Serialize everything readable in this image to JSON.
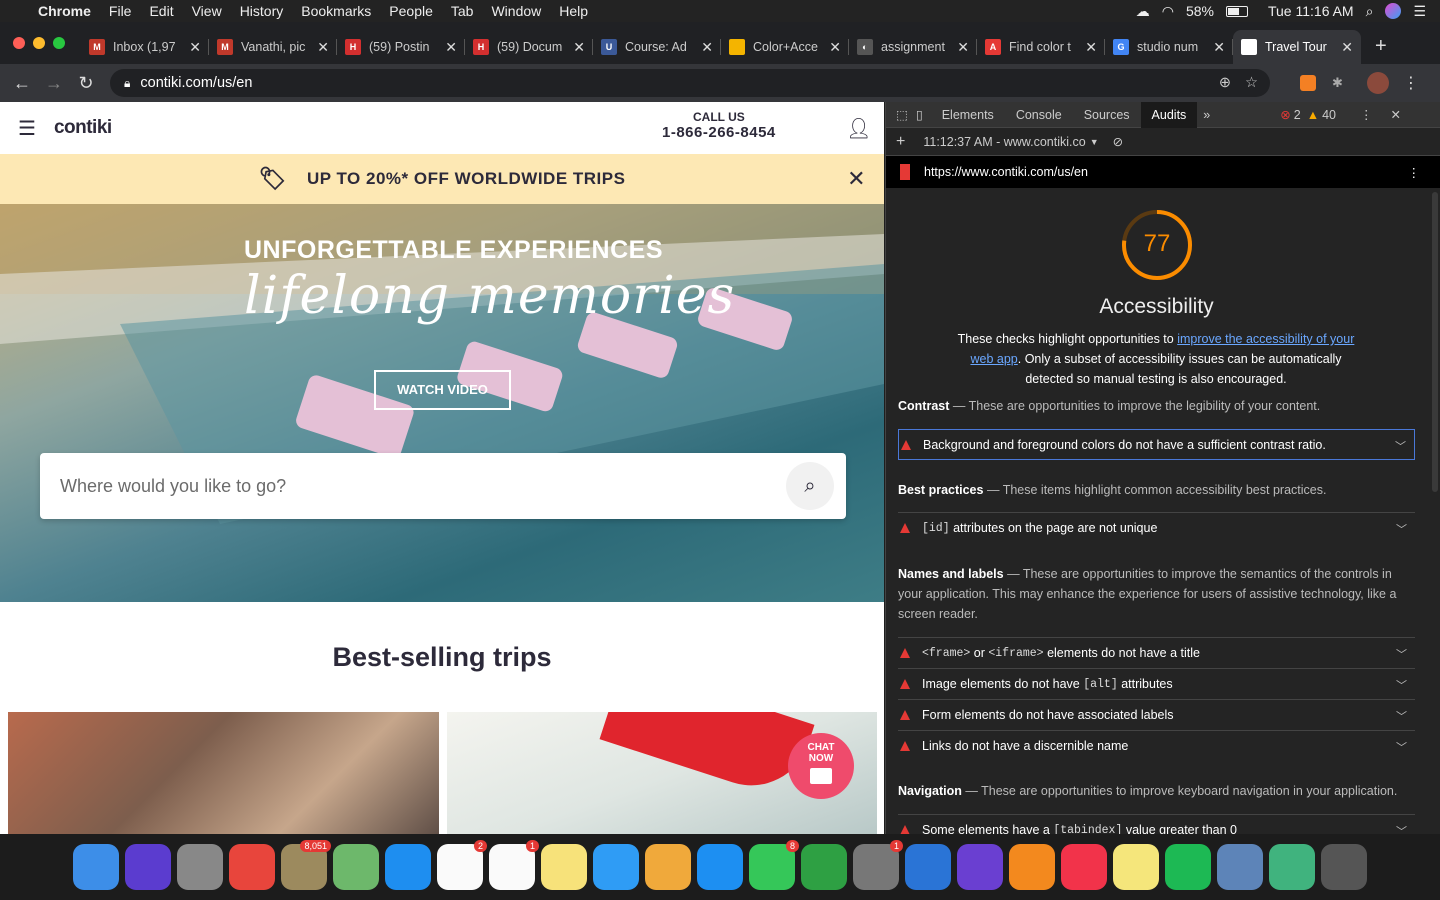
{
  "menubar": {
    "app": "Chrome",
    "items": [
      "File",
      "Edit",
      "View",
      "History",
      "Bookmarks",
      "People",
      "Tab",
      "Window",
      "Help"
    ],
    "battery": "58%",
    "clock": "Tue 11:16 AM"
  },
  "tabs": [
    {
      "title": "Inbox (1,97",
      "fav": "#c0392b",
      "favtext": "M"
    },
    {
      "title": "Vanathi, pic",
      "fav": "#c0392b",
      "favtext": "M"
    },
    {
      "title": "(59) Postin",
      "fav": "#d32f2f",
      "favtext": "H"
    },
    {
      "title": "(59) Docum",
      "fav": "#d32f2f",
      "favtext": "H"
    },
    {
      "title": "Course: Ad",
      "fav": "#3b5998",
      "favtext": "U"
    },
    {
      "title": "Color+Acce",
      "fav": "#f4b400",
      "favtext": ""
    },
    {
      "title": "assignment",
      "fav": "#555",
      "favtext": "◐"
    },
    {
      "title": "Find color t",
      "fav": "#e53935",
      "favtext": "A"
    },
    {
      "title": "studio num",
      "fav": "#4285f4",
      "favtext": "G"
    },
    {
      "title": "Travel Tour",
      "fav": "#fff",
      "favtext": "",
      "active": true
    }
  ],
  "address": {
    "url": "contiki.com/us/en"
  },
  "site": {
    "logo": "contiki",
    "call_label": "CALL US",
    "phone": "1-866-266-8454",
    "promo": "UP TO 20%* OFF WORLDWIDE TRIPS",
    "hero_title": "UNFORGETTABLE EXPERIENCES",
    "hero_script": "lifelong memories",
    "watch_video": "WATCH VIDEO",
    "search_placeholder": "Where would you like to go?",
    "best_selling": "Best-selling trips",
    "chat_line1": "CHAT",
    "chat_line2": "NOW"
  },
  "devtools": {
    "tabs": [
      "Elements",
      "Console",
      "Sources",
      "Audits"
    ],
    "errors": "2",
    "warnings": "40",
    "session": "11:12:37 AM - www.contiki.co",
    "audit_url": "https://www.contiki.com/us/en",
    "score": "77",
    "score_color": "#fb8c00",
    "category": "Accessibility",
    "intro_pre": "These checks highlight opportunities to ",
    "intro_link": "improve the accessibility of your web app",
    "intro_post": ". Only a subset of accessibility issues can be automatically detected so manual testing is also encouraged.",
    "contrast_title": "Contrast",
    "contrast_desc": "These are opportunities to improve the legibility of your content.",
    "contrast_item": "Background and foreground colors do not have a sufficient contrast ratio.",
    "bp_title": "Best practices",
    "bp_desc": "These items highlight common accessibility best practices.",
    "bp_item_code": "[id]",
    "bp_item_text": " attributes on the page are not unique",
    "names_title": "Names and labels",
    "names_desc": "These are opportunities to improve the semantics of the controls in your application. This may enhance the experience for users of assistive technology, like a screen reader.",
    "names_item1_code1": "<frame>",
    "names_item1_mid": " or ",
    "names_item1_code2": "<iframe>",
    "names_item1_text": " elements do not have a title",
    "names_item2_pre": "Image elements do not have ",
    "names_item2_code": "[alt]",
    "names_item2_post": " attributes",
    "names_item3": "Form elements do not have associated labels",
    "names_item4": "Links do not have a discernible name",
    "nav_title": "Navigation",
    "nav_desc": "These are opportunities to improve keyboard navigation in your application.",
    "nav_item_pre": "Some elements have a ",
    "nav_item_code": "[tabindex]",
    "nav_item_post": " value greater than 0"
  },
  "dock": [
    {
      "name": "finder-icon",
      "color": "#3d8ee8"
    },
    {
      "name": "siri-icon",
      "color": "#5b3ccf"
    },
    {
      "name": "launchpad-icon",
      "color": "#888"
    },
    {
      "name": "chrome-icon",
      "color": "#e8453c"
    },
    {
      "name": "mail-icon",
      "color": "#9c8a5e",
      "badge": "8,051"
    },
    {
      "name": "maps-icon",
      "color": "#6db86b"
    },
    {
      "name": "safari-icon",
      "color": "#1e8ef0"
    },
    {
      "name": "calendar-icon",
      "color": "#fafafa",
      "badge": "2"
    },
    {
      "name": "reminders-icon",
      "color": "#fafafa",
      "badge": "1"
    },
    {
      "name": "notes-icon",
      "color": "#f7e27a"
    },
    {
      "name": "messages-icon",
      "color": "#2f9cf5"
    },
    {
      "name": "photos-icon",
      "color": "#f0a93b"
    },
    {
      "name": "appstore-icon",
      "color": "#1d8ff2"
    },
    {
      "name": "facetime-icon",
      "color": "#35c759",
      "badge": "8"
    },
    {
      "name": "numbers-icon",
      "color": "#2ea043"
    },
    {
      "name": "system-preferences-icon",
      "color": "#777",
      "badge": "1"
    },
    {
      "name": "keynote-icon",
      "color": "#2a74d6"
    },
    {
      "name": "imovie-icon",
      "color": "#6a3fd1"
    },
    {
      "name": "books-icon",
      "color": "#f3891e"
    },
    {
      "name": "news-icon",
      "color": "#f2334a"
    },
    {
      "name": "stickies-icon",
      "color": "#f5e67b"
    },
    {
      "name": "spotify-icon",
      "color": "#1db954"
    },
    {
      "name": "preview-icon",
      "color": "#5d84b8"
    },
    {
      "name": "atom-icon",
      "color": "#40b37e"
    },
    {
      "name": "trash-icon",
      "color": "#555"
    }
  ]
}
